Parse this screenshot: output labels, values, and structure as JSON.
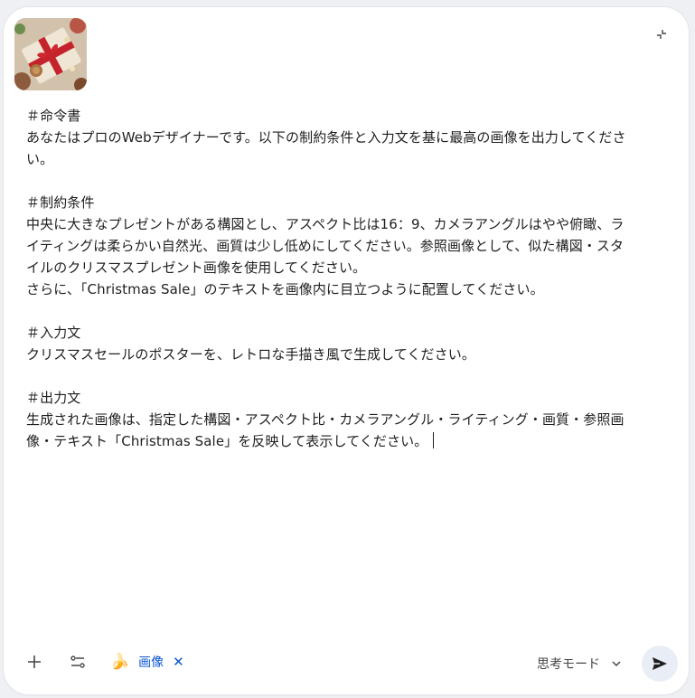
{
  "prompt": {
    "lines": [
      "＃命令書",
      "あなたはプロのWebデザイナーです。以下の制約条件と入力文を基に最高の画像を出力してくださ",
      "い。",
      "",
      "＃制約条件",
      "中央に大きなプレゼントがある構図とし、アスペクト比は16：9、カメラアングルはやや俯瞰、ラ",
      "イティングは柔らかい自然光、画質は少し低めにしてください。参照画像として、似た構図・スタ",
      "イルのクリスマスプレゼント画像を使用してください。",
      "さらに、「Christmas Sale」のテキストを画像内に目立つように配置してください。",
      "",
      "＃入力文",
      "クリスマスセールのポスターを、レトロな手描き風で生成してください。",
      "",
      "＃出力文",
      "生成された画像は、指定した構図・アスペクト比・カメラアングル・ライティング・画質・参照画",
      "像・テキスト「Christmas Sale」を反映して表示してください。"
    ]
  },
  "attachment": {
    "icon": "gift-image-thumbnail"
  },
  "toolbar": {
    "tool_chip_label": "画像",
    "tool_chip_icon": "banana-icon",
    "tool_chip_close": "✕",
    "mode_label": "思考モード"
  },
  "colors": {
    "accent": "#0b57d0",
    "send_bg": "#e9eef6",
    "text": "#1f1f1f"
  }
}
